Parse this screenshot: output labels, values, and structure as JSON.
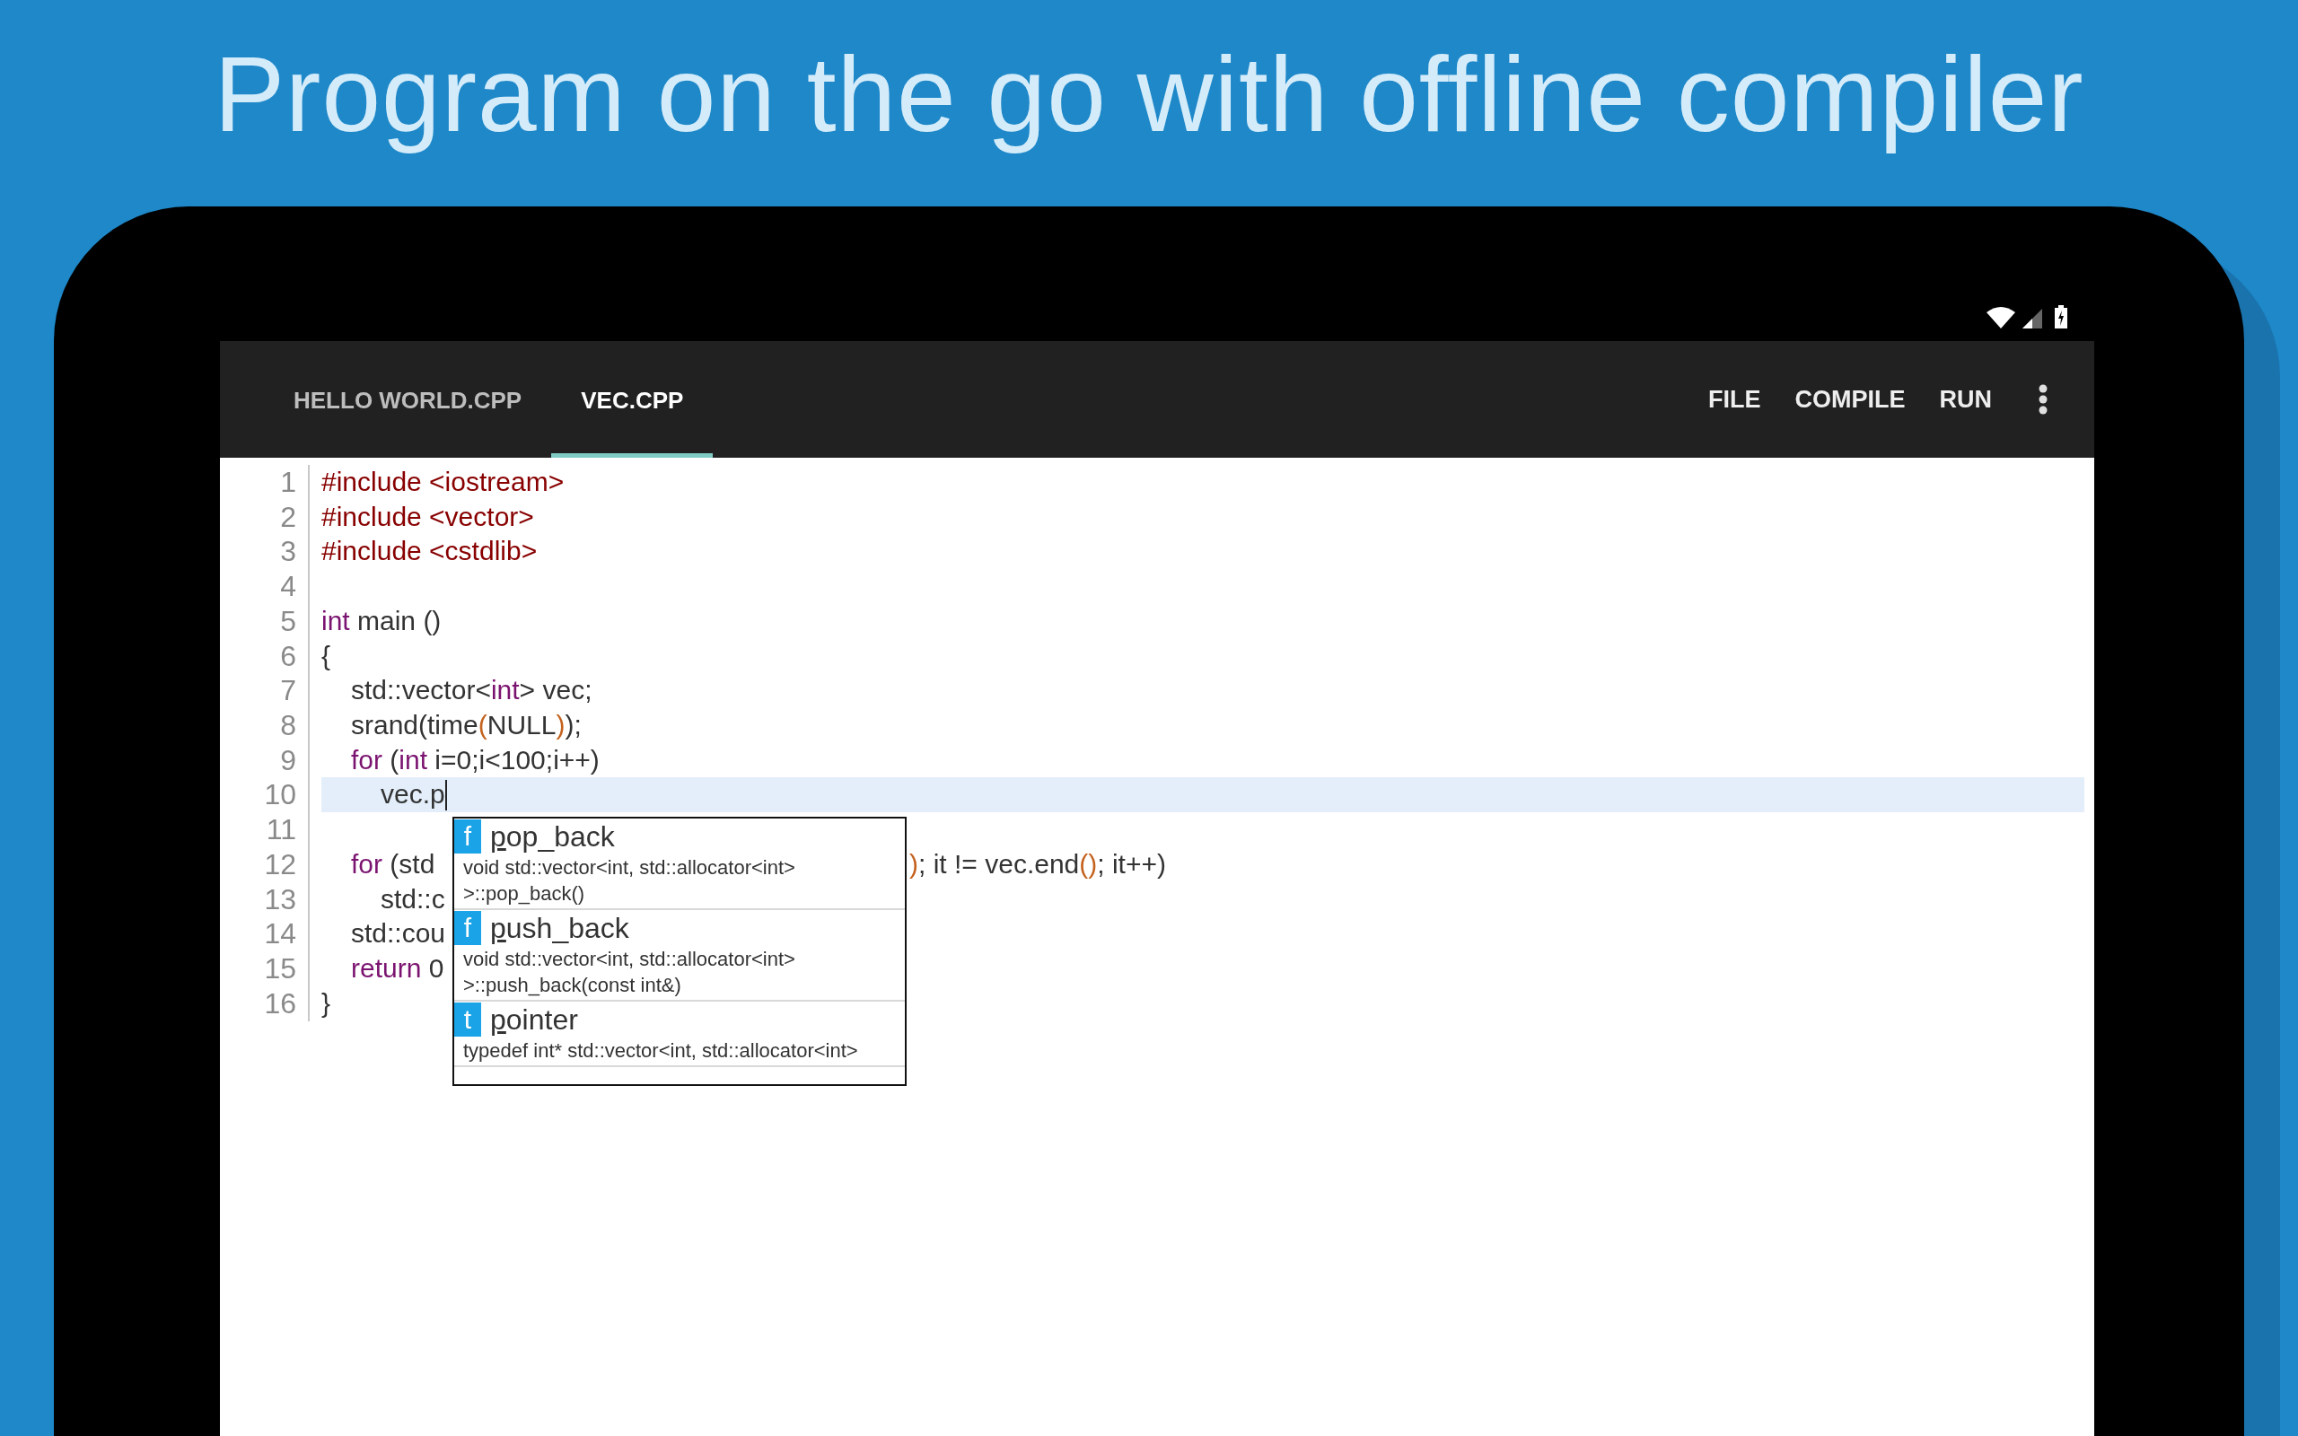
{
  "headline": "Program on the go with offline compiler",
  "tabs": [
    {
      "label": "HELLO WORLD.CPP",
      "selected": false
    },
    {
      "label": "VEC.CPP",
      "selected": true
    }
  ],
  "actions": [
    "FILE",
    "COMPILE",
    "RUN"
  ],
  "code_lines": [
    {
      "number": "1",
      "current": false,
      "tokens": [
        {
          "text": "#include <iostream>",
          "kind": "preproc"
        }
      ]
    },
    {
      "number": "2",
      "current": false,
      "tokens": [
        {
          "text": "#include <vector>",
          "kind": "preproc"
        }
      ]
    },
    {
      "number": "3",
      "current": false,
      "tokens": [
        {
          "text": "#include <cstdlib>",
          "kind": "preproc"
        }
      ]
    },
    {
      "number": "4",
      "current": false
    },
    {
      "number": "5",
      "current": false,
      "tokens": [
        {
          "text": "int",
          "kind": "keyword"
        },
        {
          "text": " main ()",
          "kind": "plain"
        }
      ]
    },
    {
      "number": "6",
      "current": false,
      "tokens": [
        {
          "text": "{",
          "kind": "plain"
        }
      ]
    },
    {
      "number": "7",
      "current": false,
      "kind": "body",
      "tokens": [
        {
          "text": "std::vector<",
          "kind": "plain"
        },
        {
          "text": "int",
          "kind": "keyword"
        },
        {
          "text": "> vec;",
          "kind": "plain"
        }
      ]
    },
    {
      "number": "8",
      "current": false,
      "kind": "body",
      "tokens": [
        {
          "text": "srand(time",
          "kind": "plain"
        },
        {
          "text": "(",
          "kind": "paren"
        },
        {
          "text": "NULL",
          "kind": "plain"
        },
        {
          "text": ")",
          "kind": "paren"
        },
        {
          "text": ");",
          "kind": "plain"
        }
      ]
    },
    {
      "number": "9",
      "current": false,
      "kind": "body",
      "tokens": [
        {
          "text": "for",
          "kind": "keyword"
        },
        {
          "text": " (",
          "kind": "plain"
        },
        {
          "text": "int",
          "kind": "keyword"
        },
        {
          "text": " i=0;i<100;i++)",
          "kind": "plain"
        }
      ]
    },
    {
      "number": "10",
      "current": true,
      "kind": "nested",
      "tokens": [
        {
          "text": "vec.p",
          "kind": "plain"
        }
      ]
    },
    {
      "number": "11",
      "current": false
    },
    {
      "number": "12",
      "current": false,
      "kind": "body",
      "tokens": [
        {
          "text": "for",
          "kind": "keyword"
        },
        {
          "text": " (std",
          "kind": "plain"
        }
      ],
      "after_popup": [
        {
          "text": ")",
          "kind": "paren"
        },
        {
          "text": "; it != vec.end",
          "kind": "plain"
        },
        {
          "text": "()",
          "kind": "paren"
        },
        {
          "text": "; it++)",
          "kind": "plain"
        }
      ]
    },
    {
      "number": "13",
      "current": false,
      "kind": "nested",
      "tokens": [
        {
          "text": "std::c",
          "kind": "plain"
        }
      ]
    },
    {
      "number": "14",
      "current": false,
      "kind": "body",
      "tokens": [
        {
          "text": "std::cou",
          "kind": "plain"
        }
      ]
    },
    {
      "number": "15",
      "current": false,
      "kind": "body",
      "tokens": [
        {
          "text": "return",
          "kind": "keyword"
        },
        {
          "text": " 0",
          "kind": "plain"
        }
      ]
    },
    {
      "number": "16",
      "current": false,
      "tokens": [
        {
          "text": "}",
          "kind": "plain"
        }
      ]
    }
  ],
  "autocomplete": {
    "items": [
      {
        "badge": "f",
        "match": "p",
        "rest": "op_back",
        "detail": [
          "void std::vector<int, std::allocator<int>",
          ">::pop_back()"
        ]
      },
      {
        "badge": "f",
        "match": "p",
        "rest": "ush_back",
        "detail": [
          "void std::vector<int, std::allocator<int>",
          ">::push_back(const int&)"
        ]
      },
      {
        "badge": "t",
        "match": "p",
        "rest": "ointer",
        "detail": [
          "typedef int* std::vector<int, std::allocator<int>"
        ]
      }
    ]
  }
}
